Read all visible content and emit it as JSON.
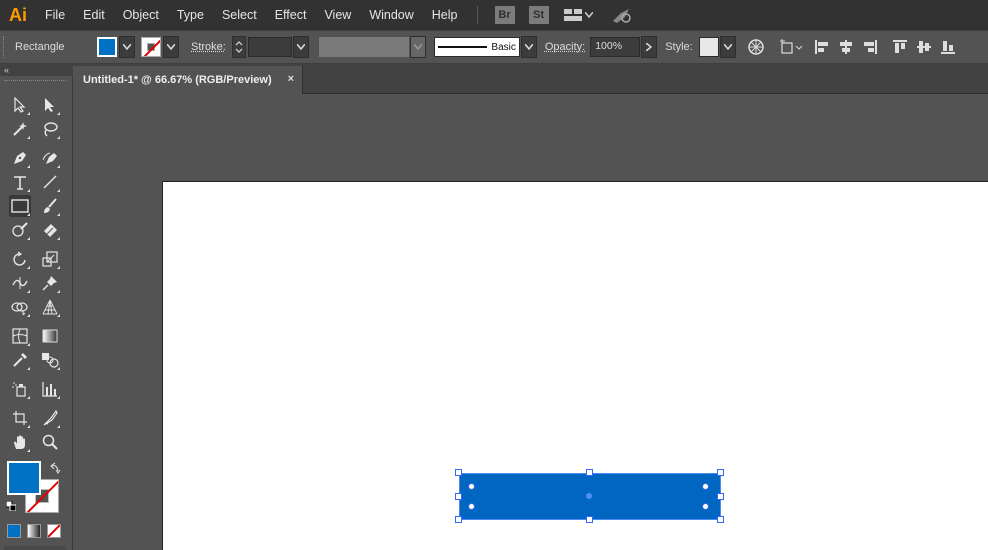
{
  "app": {
    "logo": "Ai",
    "menus": [
      "File",
      "Edit",
      "Object",
      "Type",
      "Select",
      "Effect",
      "View",
      "Window",
      "Help"
    ],
    "bridge_label": "Br",
    "stock_label": "St"
  },
  "control_bar": {
    "tool_name": "Rectangle",
    "stroke_label": "Stroke:",
    "stroke_value": "",
    "brush_label": "Basic",
    "opacity_label": "Opacity:",
    "opacity_value": "100%",
    "style_label": "Style:",
    "fill_color": "#0072c6"
  },
  "document": {
    "tab_title": "Untitled-1* @ 66.67% (RGB/Preview)",
    "close_label": "×"
  },
  "tools": {
    "active": "rectangle-tool",
    "fill_color": "#0072c6",
    "stroke": "none"
  },
  "canvas": {
    "rectangle_fill": "#0066c2",
    "artboard_color": "#ffffff"
  }
}
